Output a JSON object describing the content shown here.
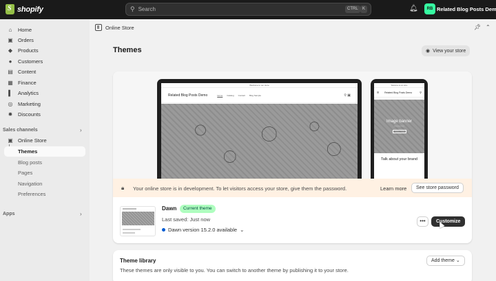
{
  "topbar": {
    "brand": "shopify",
    "search_placeholder": "Search",
    "kbd_ctrl": "CTRL",
    "kbd_k": "K",
    "store_initials": "RB",
    "store_name": "Related Blog Posts Demo"
  },
  "sidebar": {
    "items": [
      {
        "label": "Home",
        "icon": "home-icon"
      },
      {
        "label": "Orders",
        "icon": "orders-icon"
      },
      {
        "label": "Products",
        "icon": "tag-icon"
      },
      {
        "label": "Customers",
        "icon": "person-icon"
      },
      {
        "label": "Content",
        "icon": "content-icon"
      },
      {
        "label": "Finance",
        "icon": "bank-icon"
      },
      {
        "label": "Analytics",
        "icon": "chart-icon"
      },
      {
        "label": "Marketing",
        "icon": "target-icon"
      },
      {
        "label": "Discounts",
        "icon": "discount-icon"
      }
    ],
    "sales_channels_label": "Sales channels",
    "online_store_label": "Online Store",
    "sub_items": [
      "Themes",
      "Blog posts",
      "Pages",
      "Navigation",
      "Preferences"
    ],
    "apps_label": "Apps"
  },
  "breadcrumb": "Online Store",
  "page": {
    "title": "Themes",
    "view_store_label": "View your store"
  },
  "preview": {
    "announcement": "Welcome to our store",
    "site_title": "Related Blog Posts Demo",
    "nav": [
      "Home",
      "Catalog",
      "Contact",
      "Blog Sample"
    ],
    "mobile_hero_title": "Image banner",
    "mobile_talk": "Talk about your brand"
  },
  "banner": {
    "text": "Your online store is in development. To let visitors access your store, give them the password.",
    "learn_more": "Learn more",
    "password_button": "See store password"
  },
  "current_theme": {
    "name": "Dawn",
    "badge": "Current theme",
    "last_saved": "Last saved: Just now",
    "version": "Dawn version 15.2.0 available",
    "more_label": "•••",
    "customize_label": "Customize"
  },
  "library": {
    "title": "Theme library",
    "description": "These themes are only visible to you. You can switch to another theme by publishing it to your store.",
    "add_label": "Add theme"
  },
  "colors": {
    "topbar": "#1a1a1a",
    "brand_green": "#95bf47",
    "store_badge": "#36fba1",
    "banner_bg": "#fff1e3",
    "badge_bg": "#affebf",
    "primary_button": "#303030"
  }
}
